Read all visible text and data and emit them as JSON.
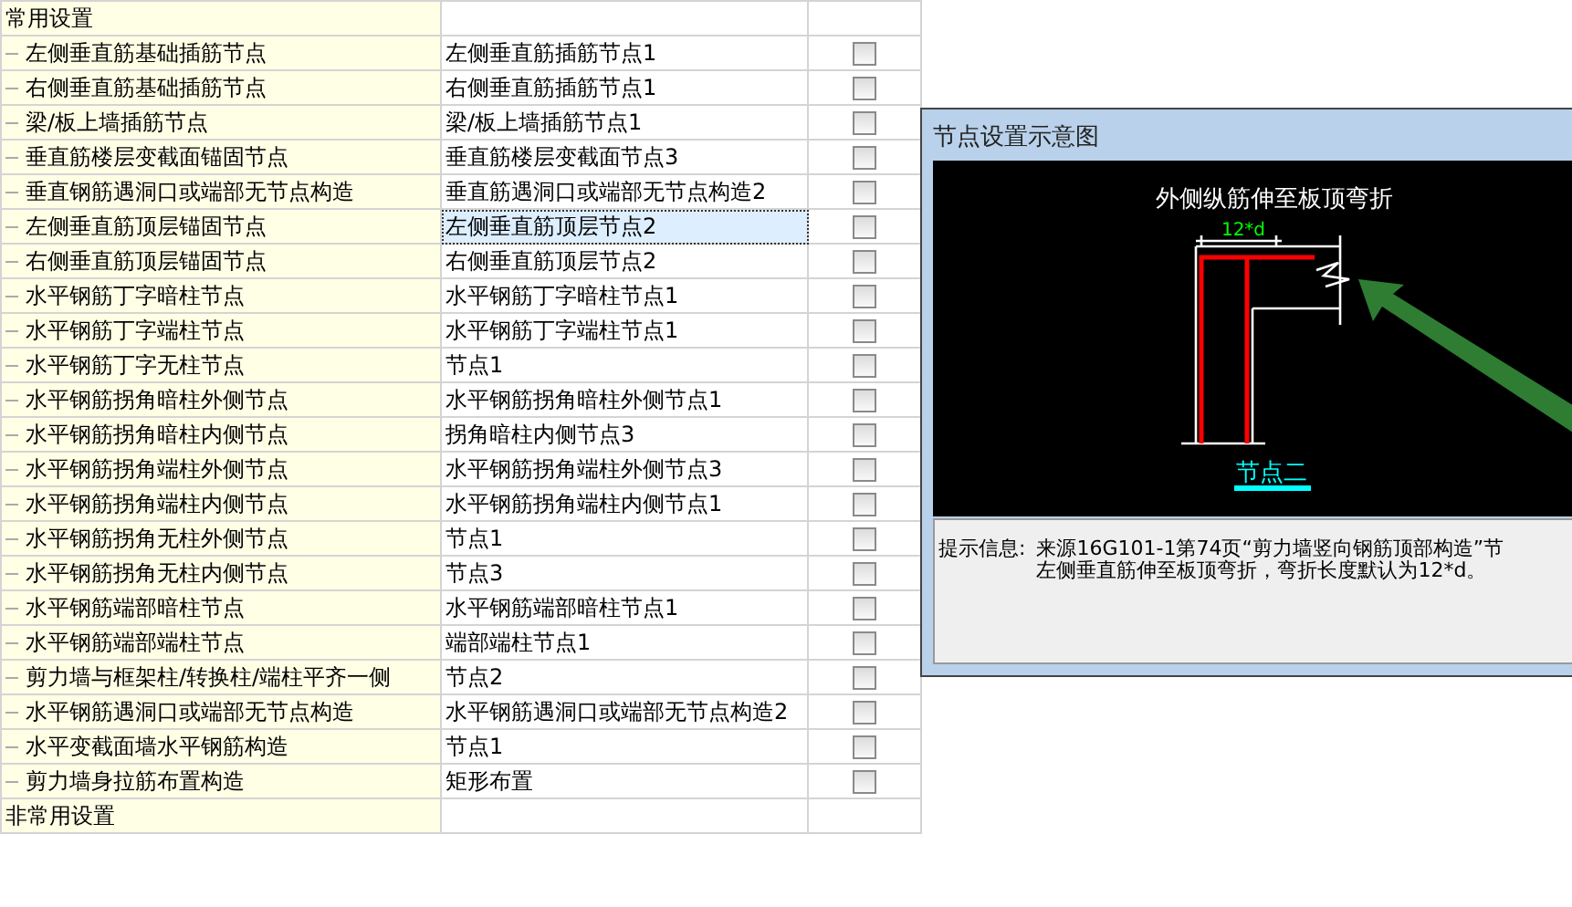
{
  "settings": {
    "groups": [
      {
        "title": "常用设置",
        "rows": [
          {
            "name": "左侧垂直筋基础插筋节点",
            "value": "左侧垂直筋插筋节点1",
            "selected": false,
            "checked": false
          },
          {
            "name": "右侧垂直筋基础插筋节点",
            "value": "右侧垂直筋插筋节点1",
            "selected": false,
            "checked": false
          },
          {
            "name": "梁/板上墙插筋节点",
            "value": "梁/板上墙插筋节点1",
            "selected": false,
            "checked": false
          },
          {
            "name": "垂直筋楼层变截面锚固节点",
            "value": "垂直筋楼层变截面节点3",
            "selected": false,
            "checked": false
          },
          {
            "name": "垂直钢筋遇洞口或端部无节点构造",
            "value": "垂直筋遇洞口或端部无节点构造2",
            "selected": false,
            "checked": false
          },
          {
            "name": "左侧垂直筋顶层锚固节点",
            "value": "左侧垂直筋顶层节点2",
            "selected": true,
            "checked": false
          },
          {
            "name": "右侧垂直筋顶层锚固节点",
            "value": "右侧垂直筋顶层节点2",
            "selected": false,
            "checked": false
          },
          {
            "name": "水平钢筋丁字暗柱节点",
            "value": "水平钢筋丁字暗柱节点1",
            "selected": false,
            "checked": false
          },
          {
            "name": "水平钢筋丁字端柱节点",
            "value": "水平钢筋丁字端柱节点1",
            "selected": false,
            "checked": false
          },
          {
            "name": "水平钢筋丁字无柱节点",
            "value": "节点1",
            "selected": false,
            "checked": false
          },
          {
            "name": "水平钢筋拐角暗柱外侧节点",
            "value": "水平钢筋拐角暗柱外侧节点1",
            "selected": false,
            "checked": false
          },
          {
            "name": "水平钢筋拐角暗柱内侧节点",
            "value": "拐角暗柱内侧节点3",
            "selected": false,
            "checked": false
          },
          {
            "name": "水平钢筋拐角端柱外侧节点",
            "value": "水平钢筋拐角端柱外侧节点3",
            "selected": false,
            "checked": false
          },
          {
            "name": "水平钢筋拐角端柱内侧节点",
            "value": "水平钢筋拐角端柱内侧节点1",
            "selected": false,
            "checked": false
          },
          {
            "name": "水平钢筋拐角无柱外侧节点",
            "value": "节点1",
            "selected": false,
            "checked": false
          },
          {
            "name": "水平钢筋拐角无柱内侧节点",
            "value": "节点3",
            "selected": false,
            "checked": false
          },
          {
            "name": "水平钢筋端部暗柱节点",
            "value": "水平钢筋端部暗柱节点1",
            "selected": false,
            "checked": false
          },
          {
            "name": "水平钢筋端部端柱节点",
            "value": "端部端柱节点1",
            "selected": false,
            "checked": false
          },
          {
            "name": "剪力墙与框架柱/转换柱/端柱平齐一侧",
            "value": "节点2",
            "selected": false,
            "checked": false
          },
          {
            "name": "水平钢筋遇洞口或端部无节点构造",
            "value": "水平钢筋遇洞口或端部无节点构造2",
            "selected": false,
            "checked": false
          },
          {
            "name": "水平变截面墙水平钢筋构造",
            "value": "节点1",
            "selected": false,
            "checked": false
          },
          {
            "name": "剪力墙身拉筋布置构造",
            "value": "矩形布置",
            "selected": false,
            "checked": false
          }
        ]
      },
      {
        "title": "非常用设置"
      }
    ]
  },
  "dialog": {
    "title": "节点设置示意图",
    "diagram": {
      "caption": "外侧纵筋伸至板顶弯折",
      "dimension": "12*d",
      "node_label": "节点二"
    },
    "info_label": "提示信息:",
    "info_lines": [
      "来源16G101-1第74页“剪力墙竖向钢筋顶部构造”节",
      "左侧垂直筋伸至板顶弯折，弯折长度默认为12*d。"
    ]
  }
}
